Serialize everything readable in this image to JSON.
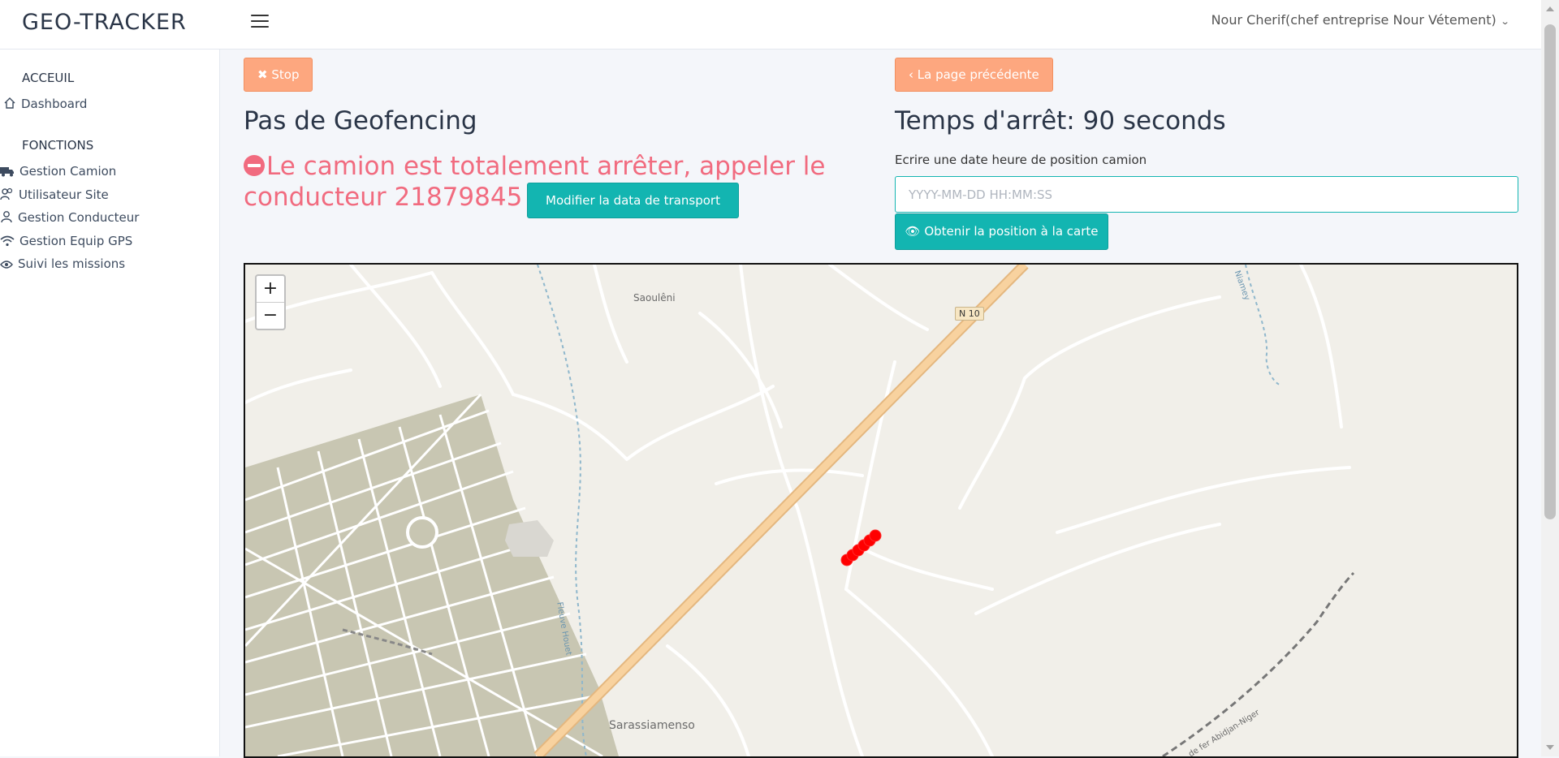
{
  "app": {
    "brand": "GEO-TRACKER"
  },
  "header": {
    "user": "Nour Cherif(chef entreprise Nour Vétement)"
  },
  "sidebar": {
    "sections": [
      {
        "title": "ACCEUIL",
        "items": [
          {
            "label": "Dashboard",
            "icon": "home-icon"
          }
        ]
      },
      {
        "title": "FONCTIONS",
        "items": [
          {
            "label": "Gestion Camion",
            "icon": "truck-icon"
          },
          {
            "label": "Utilisateur Site",
            "icon": "users-icon"
          },
          {
            "label": "Gestion Conducteur",
            "icon": "user-icon"
          },
          {
            "label": "Gestion Equip GPS",
            "icon": "wifi-icon"
          },
          {
            "label": "Suivi les missions",
            "icon": "eye-icon"
          }
        ]
      }
    ]
  },
  "main": {
    "stop_button": "Stop",
    "back_button": "La page précédente",
    "geofence_title": "Pas de Geofencing",
    "stop_time_title": "Temps d'arrêt: 90 seconds",
    "alert_text": "Le camion est totalement arrêter, appeler le conducteur 21879845",
    "modify_button": "Modifier la data de transport",
    "date_field": {
      "label": "Ecrire une date heure de position camion",
      "placeholder": "YYYY-MM-DD HH:MM:SS",
      "value": ""
    },
    "get_position_button": "Obtenir la position à la carte"
  },
  "map": {
    "zoom_in": "+",
    "zoom_out": "−",
    "labels": {
      "town_north": "Saoulêni",
      "town_south": "Sarassiamenso",
      "road_ref": "N 10",
      "river": "Fleuve Houet",
      "river_ne": "Niamey",
      "railway": "de fer Abidjan-Niger"
    },
    "marker_color": "#ff0000"
  },
  "colors": {
    "accent": "#13b5b1",
    "warning": "#fda77f",
    "alert": "#f16b7f"
  }
}
